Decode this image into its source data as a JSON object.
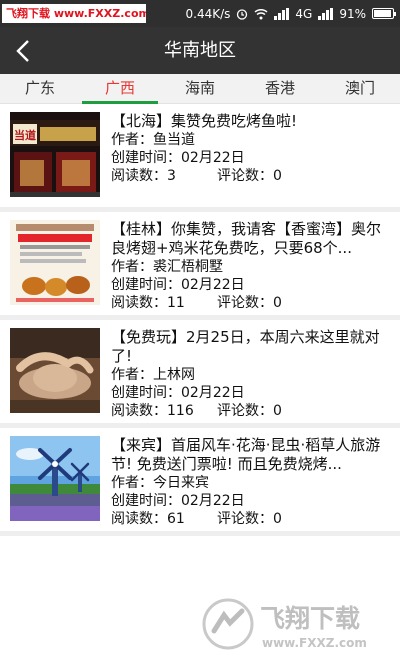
{
  "status_bar": {
    "watermark": "飞翔下载 www.FXXZ.com",
    "speed": "0.44K/s",
    "network": "4G",
    "battery": "91%"
  },
  "header": {
    "title": "华南地区"
  },
  "tabs": [
    {
      "label": "广东"
    },
    {
      "label": "广西"
    },
    {
      "label": "海南"
    },
    {
      "label": "香港"
    },
    {
      "label": "澳门"
    }
  ],
  "list_labels": {
    "author": "作者：",
    "created": "创建时间：",
    "reads": "阅读数：",
    "comments": "评论数："
  },
  "items": [
    {
      "title": "【北海】集赞免费吃烤鱼啦!",
      "author": "鱼当道",
      "created": "02月22日",
      "reads": "3",
      "comments": "0",
      "thumb_text": "当道"
    },
    {
      "title": "【桂林】你集赞，我请客【香蜜湾】奥尔良烤翅+鸡米花免费吃，只要68个...",
      "author": "裘汇梧桐墅",
      "created": "02月22日",
      "reads": "11",
      "comments": "0"
    },
    {
      "title": "【免费玩】2月25日，本周六来这里就对了!",
      "author": "上林网",
      "created": "02月22日",
      "reads": "116",
      "comments": "0"
    },
    {
      "title": "【来宾】首届风车·花海·昆虫·稻草人旅游节! 免费送门票啦! 而且免费烧烤...",
      "author": "今日来宾",
      "created": "02月22日",
      "reads": "61",
      "comments": "0"
    }
  ],
  "bottom_watermark": {
    "text": "飞翔下载",
    "url": "www.FXXZ.com"
  },
  "colors": {
    "header": "#333333",
    "active_tab": "#e53935",
    "tab_underline": "#1e9e3e"
  }
}
